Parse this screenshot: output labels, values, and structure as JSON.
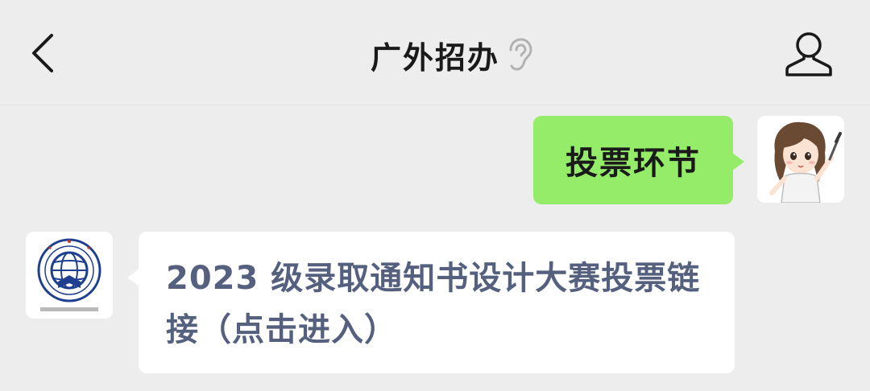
{
  "header": {
    "back_icon": "chevron-left-icon",
    "title": "广外招办",
    "mute_icon": "ear-icon",
    "profile_icon": "person-icon"
  },
  "messages": [
    {
      "direction": "outgoing",
      "text": "投票环节",
      "avatar": "user-avatar",
      "bubble_color": "#95ec69"
    },
    {
      "direction": "incoming",
      "text": "2023 级录取通知书设计大赛投票链接（点击进入）",
      "avatar": "school-logo-avatar",
      "text_color": "#55607f"
    }
  ],
  "colors": {
    "background": "#ededed",
    "outgoing_bubble": "#95ec69",
    "incoming_bubble": "#ffffff",
    "logo_blue": "#1f3f8f"
  }
}
